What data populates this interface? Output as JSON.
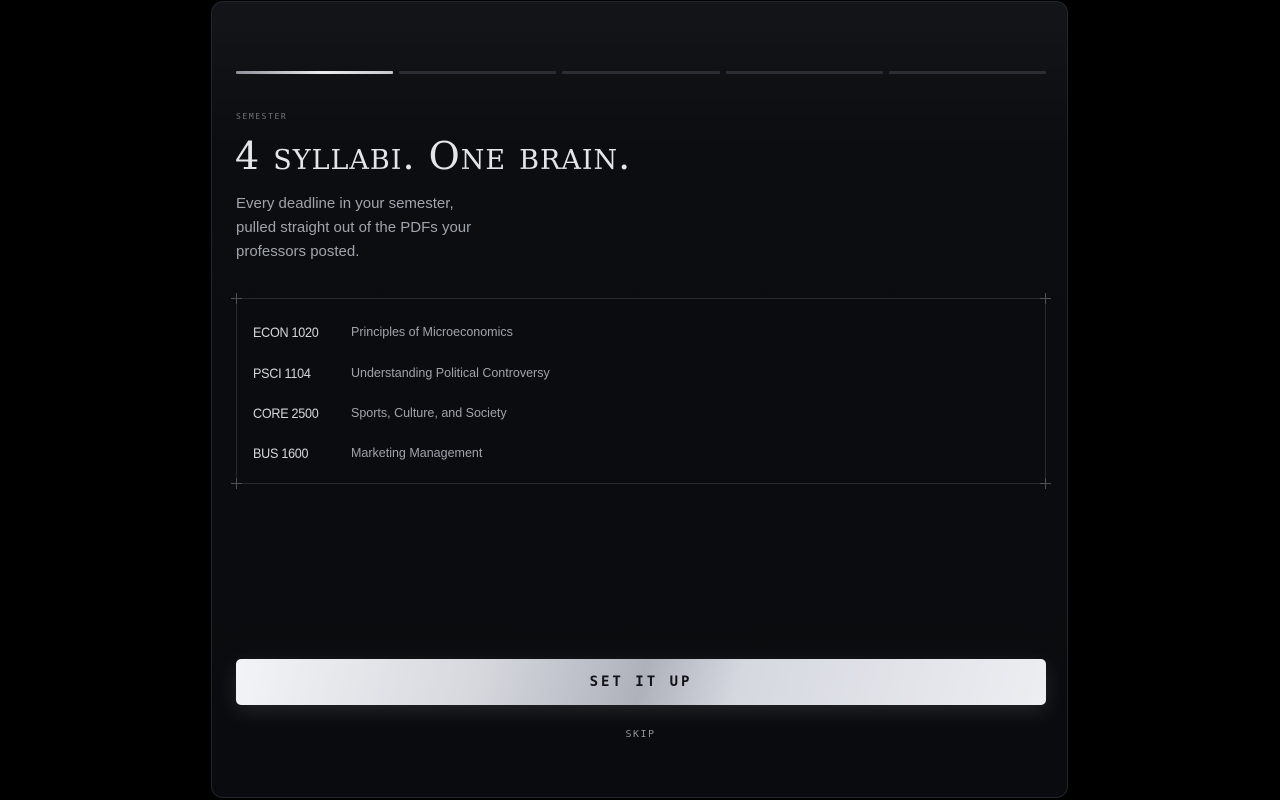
{
  "onboarding": {
    "progress": {
      "total_steps": 5,
      "current_step": 1
    },
    "eyebrow": "SEMESTER",
    "headline": "4 syllabi. One brain.",
    "subtitle": "Every deadline in your semester, pulled straight out of the PDFs your professors posted.",
    "courses": [
      {
        "code": "ECON 1020",
        "name": "Principles of Microeconomics"
      },
      {
        "code": "PSCI 1104",
        "name": "Understanding Political Controversy"
      },
      {
        "code": "CORE 2500",
        "name": "Sports, Culture, and Society"
      },
      {
        "code": "BUS 1600",
        "name": "Marketing Management"
      }
    ],
    "primary_button_label": "SET IT UP",
    "skip_label": "SKIP"
  },
  "colors": {
    "background": "#000000",
    "panel": "#0b0d10",
    "text_primary": "#e3e5e9",
    "text_secondary": "#9fa3ab",
    "button_silver": "#d6d8de"
  }
}
